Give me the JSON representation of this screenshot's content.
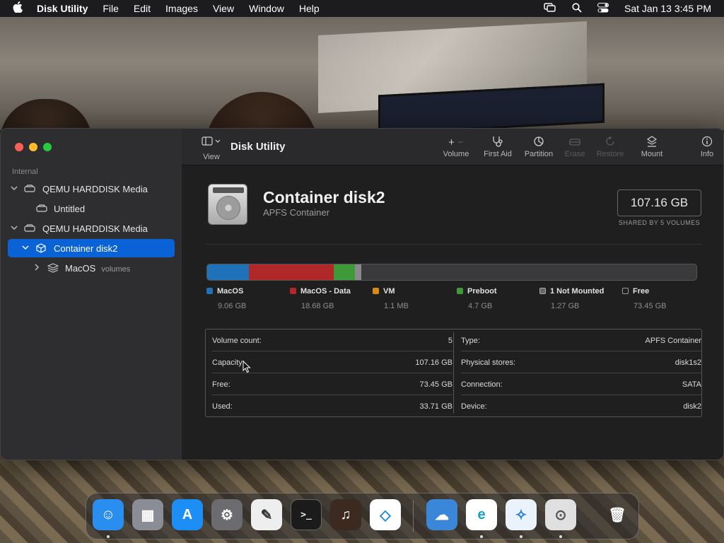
{
  "menubar": {
    "app_name": "Disk Utility",
    "items": [
      "File",
      "Edit",
      "Images",
      "View",
      "Window",
      "Help"
    ],
    "datetime": "Sat Jan 13  3:45 PM"
  },
  "sidebar": {
    "section_title": "Internal",
    "items": [
      {
        "label": "QEMU HARDDISK Media",
        "sub": ""
      },
      {
        "label": "Untitled",
        "sub": ""
      },
      {
        "label": "QEMU HARDDISK Media",
        "sub": ""
      },
      {
        "label": "Container disk2",
        "sub": ""
      },
      {
        "label": "MacOS",
        "sub": "volumes"
      }
    ]
  },
  "toolbar": {
    "view_label": "View",
    "title": "Disk Utility",
    "buttons": {
      "volume": "Volume",
      "first_aid": "First Aid",
      "partition": "Partition",
      "erase": "Erase",
      "restore": "Restore",
      "mount": "Mount",
      "info": "Info"
    }
  },
  "detail": {
    "title": "Container disk2",
    "subtitle": "APFS Container",
    "capacity": "107.16 GB",
    "capacity_note": "SHARED BY 5 VOLUMES"
  },
  "usage": {
    "total_gb": 107.16,
    "segments": [
      {
        "name": "MacOS",
        "size": "9.06 GB",
        "gb": 9.06,
        "color": "#1f72b8"
      },
      {
        "name": "MacOS - Data",
        "size": "18.68 GB",
        "gb": 18.68,
        "color": "#b02828"
      },
      {
        "name": "VM",
        "size": "1.1 MB",
        "gb": 0.0011,
        "color": "#d98a14"
      },
      {
        "name": "Preboot",
        "size": "4.7 GB",
        "gb": 4.7,
        "color": "#3e9a38"
      },
      {
        "name": "1 Not Mounted",
        "size": "1.27 GB",
        "gb": 1.27,
        "color": "#8a8a8e"
      },
      {
        "name": "Free",
        "size": "73.45 GB",
        "gb": 73.45,
        "color": "#3a3a3c"
      }
    ]
  },
  "info": {
    "left": [
      {
        "k": "Volume count:",
        "v": "5"
      },
      {
        "k": "Capacity:",
        "v": "107.16 GB"
      },
      {
        "k": "Free:",
        "v": "73.45 GB"
      },
      {
        "k": "Used:",
        "v": "33.71 GB"
      }
    ],
    "right": [
      {
        "k": "Type:",
        "v": "APFS Container"
      },
      {
        "k": "Physical stores:",
        "v": "disk1s2"
      },
      {
        "k": "Connection:",
        "v": "SATA"
      },
      {
        "k": "Device:",
        "v": "disk2"
      }
    ]
  },
  "dock": {
    "apps": [
      {
        "name": "finder-icon",
        "color": "#2a8df0",
        "running": true
      },
      {
        "name": "launchpad-icon",
        "color": "#8a8d96",
        "running": false
      },
      {
        "name": "app-store-icon",
        "color": "#1c8ef5",
        "running": false
      },
      {
        "name": "system-settings-icon",
        "color": "#6b6b70",
        "running": false
      },
      {
        "name": "textedit-icon",
        "color": "#eeeeee",
        "running": false
      },
      {
        "name": "terminal-icon",
        "color": "#1b1b1b",
        "running": false
      },
      {
        "name": "garageband-icon",
        "color": "#3c2a20",
        "running": false
      },
      {
        "name": "vscode-icon",
        "color": "#ffffff",
        "running": false
      },
      {
        "name": "weather-icon",
        "color": "#3a86d8",
        "running": false
      },
      {
        "name": "edge-icon",
        "color": "#ffffff",
        "running": true
      },
      {
        "name": "safari-icon",
        "color": "#eaf2fb",
        "running": true
      },
      {
        "name": "disk-utility-icon",
        "color": "#e0e0e0",
        "running": true
      },
      {
        "name": "trash-icon",
        "color": "#9a9a9a",
        "running": false
      }
    ]
  }
}
